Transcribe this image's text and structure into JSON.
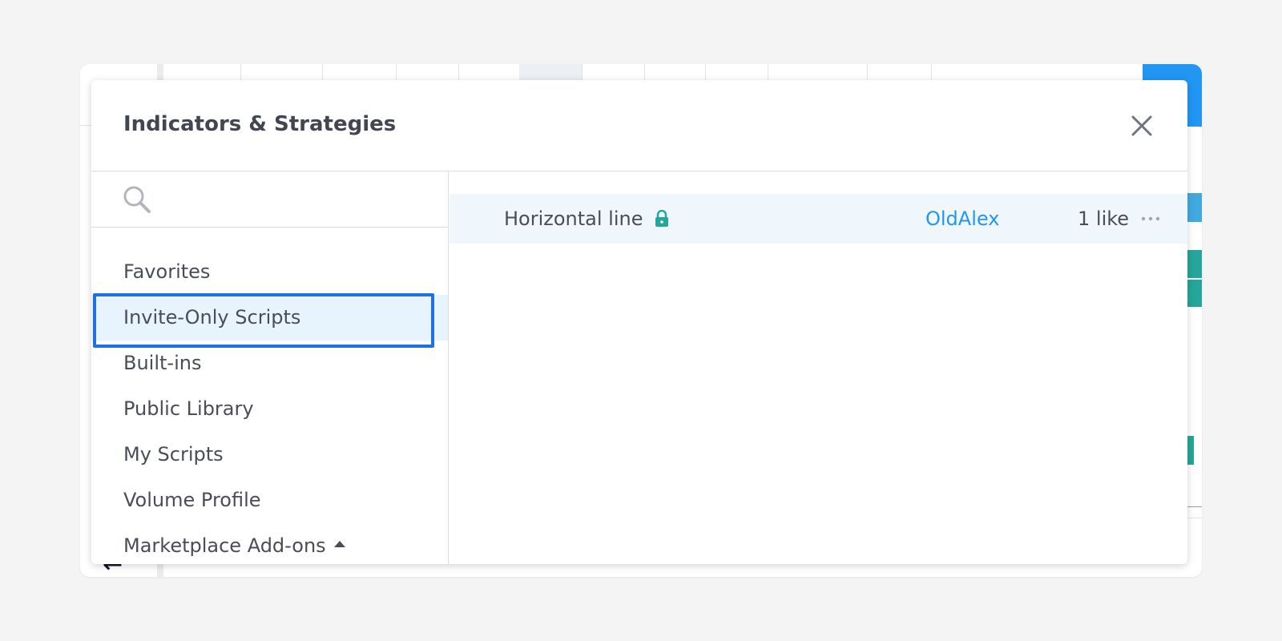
{
  "dialog": {
    "title": "Indicators & Strategies",
    "close_icon": "close-icon"
  },
  "search": {
    "placeholder": "",
    "value": "",
    "icon": "search-icon"
  },
  "sidebar": {
    "items": [
      {
        "label": "Favorites"
      },
      {
        "label": "Invite-Only Scripts",
        "selected": true
      },
      {
        "label": "Built-ins"
      },
      {
        "label": "Public Library"
      },
      {
        "label": "My Scripts"
      },
      {
        "label": "Volume Profile"
      },
      {
        "label": "Marketplace Add-ons",
        "icon": "caret-up-icon"
      }
    ]
  },
  "scripts": [
    {
      "name": "Horizontal line",
      "icon": "lock-icon",
      "author": "OldAlex",
      "likes": "1 like",
      "more_icon": "more-icon"
    }
  ],
  "colors": {
    "accent": "#2196f3",
    "selection_border": "#1f6fe5",
    "selected_bg": "#e8f4fd",
    "lock": "#26a69a"
  }
}
